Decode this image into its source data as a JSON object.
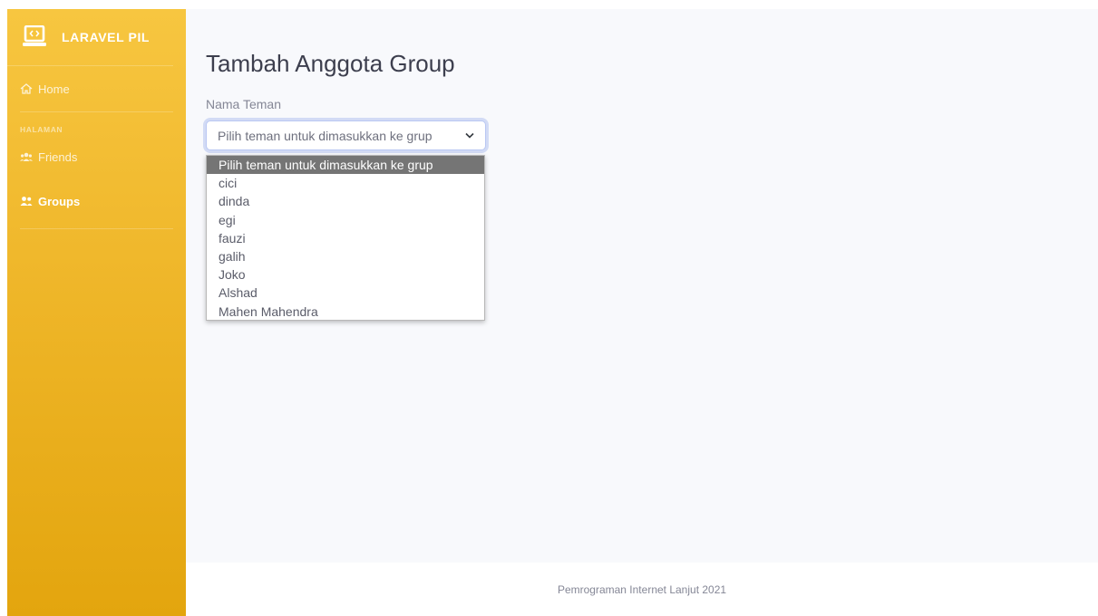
{
  "sidebar": {
    "brand": {
      "icon": "laptop-code-icon",
      "title": "LARAVEL PIL"
    },
    "nav": [
      {
        "icon": "home-icon",
        "label": "Home"
      }
    ],
    "section_heading": "HALAMAN",
    "section_items": [
      {
        "icon": "users-icon",
        "label": "Friends"
      },
      {
        "icon": "user-group-icon",
        "label": "Groups"
      }
    ]
  },
  "main": {
    "title": "Tambah Anggota Group",
    "form": {
      "label": "Nama Teman",
      "select": {
        "value": "Pilih teman untuk dimasukkan ke grup",
        "options": [
          "Pilih teman untuk dimasukkan ke grup",
          "cici",
          "dinda",
          "egi",
          "fauzi",
          "galih",
          "Joko",
          "Alshad",
          "Mahen Mahendra"
        ],
        "highlighted_index": 0
      }
    }
  },
  "footer": {
    "text": "Pemrograman Internet Lanjut 2021"
  },
  "colors": {
    "sidebar_top": "#f7c640",
    "sidebar_bottom": "#e3a50e",
    "content_bg": "#f8f9fc",
    "focus_ring": "#bac8f3",
    "highlight_option": "#757575"
  }
}
